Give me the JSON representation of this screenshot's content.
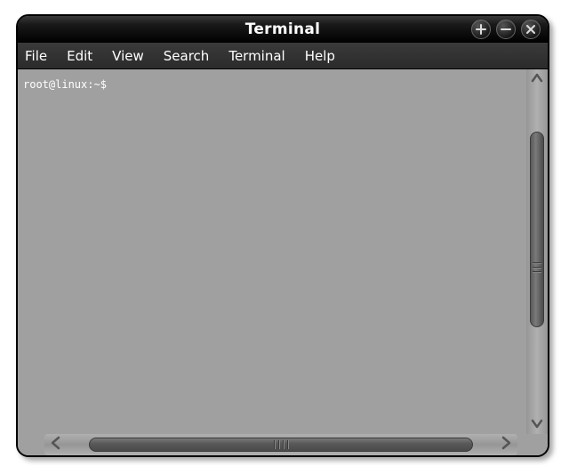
{
  "window": {
    "title": "Terminal"
  },
  "menubar": {
    "items": [
      {
        "label": "File"
      },
      {
        "label": "Edit"
      },
      {
        "label": "View"
      },
      {
        "label": "Search"
      },
      {
        "label": "Terminal"
      },
      {
        "label": "Help"
      }
    ]
  },
  "terminal": {
    "prompt": "root@linux:~$ "
  }
}
